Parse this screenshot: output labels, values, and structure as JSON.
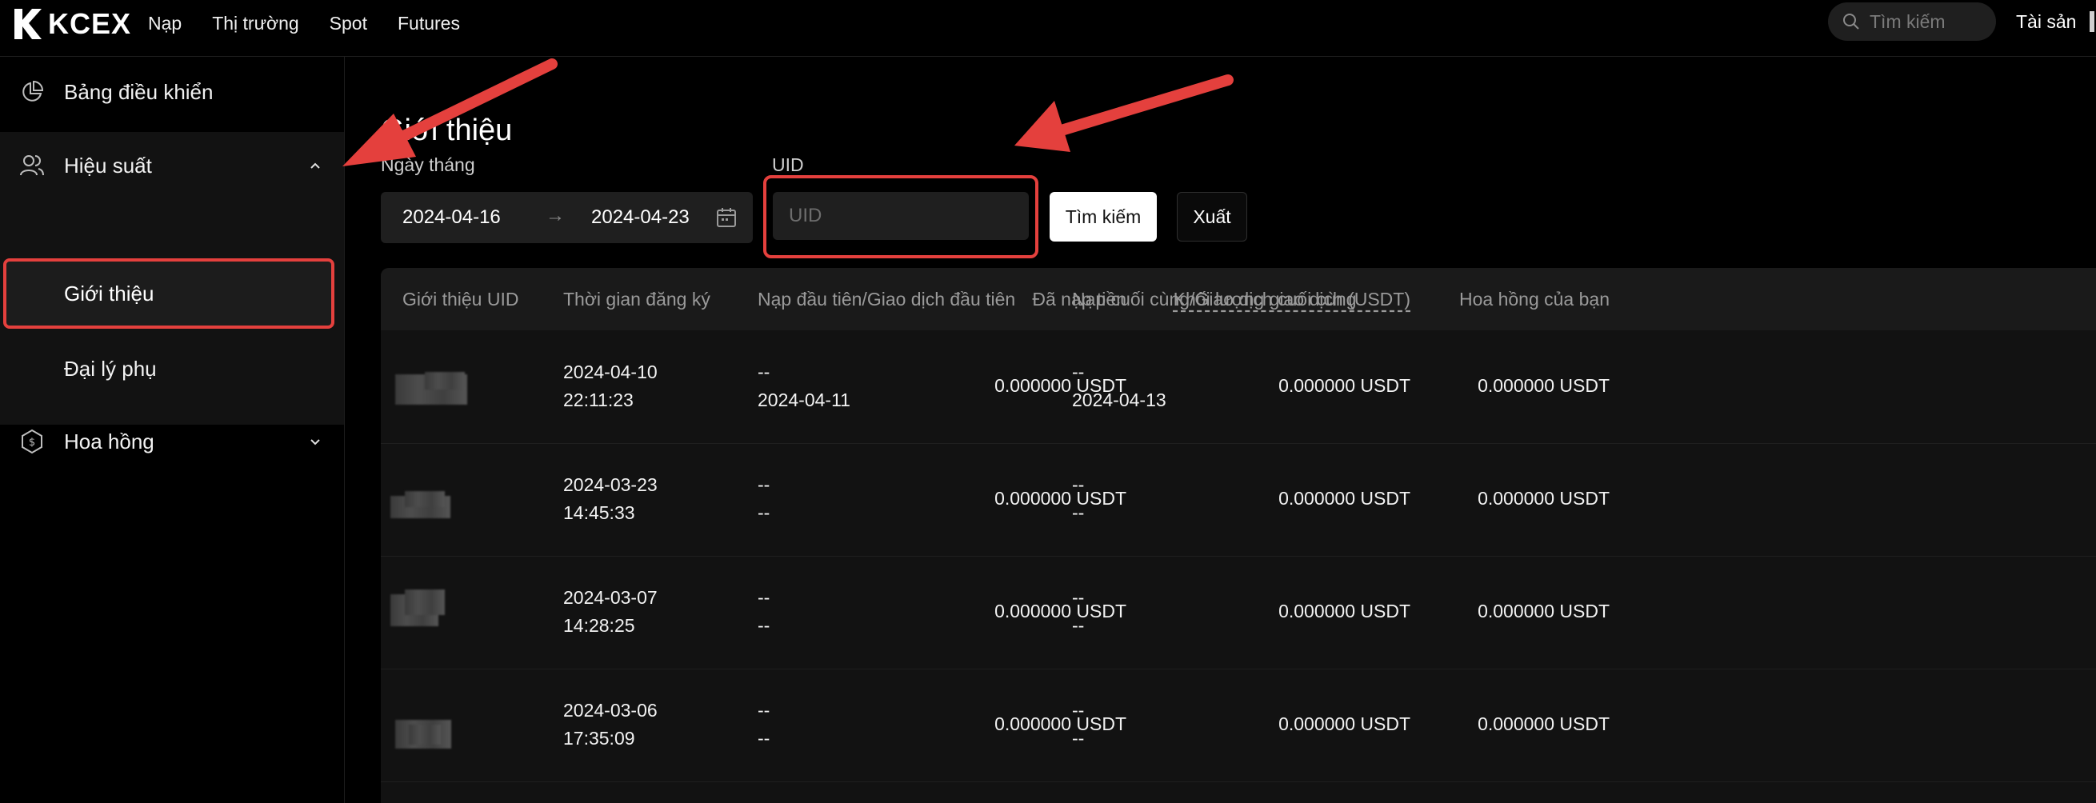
{
  "brand": {
    "name": "KCEX"
  },
  "nav": {
    "items": [
      "Nạp",
      "Thị trường",
      "Spot",
      "Futures"
    ]
  },
  "header": {
    "search_placeholder": "Tìm kiếm",
    "assets": "Tài sản"
  },
  "sidebar": {
    "items": [
      {
        "label": "Bảng điều khiển",
        "icon": "pie-chart-icon"
      },
      {
        "label": "Hiệu suất",
        "icon": "users-icon",
        "expanded": true
      },
      {
        "label": "Giới thiệu",
        "active": true
      },
      {
        "label": "Đại lý phụ"
      },
      {
        "label": "Hoa hồng",
        "icon": "coin-icon",
        "expanded": false
      }
    ]
  },
  "main": {
    "title": "Giới thiệu",
    "filters": {
      "date_label": "Ngày tháng",
      "date_start": "2024-04-16",
      "date_arrow": "→",
      "date_end": "2024-04-23",
      "uid_label": "UID",
      "uid_placeholder": "UID",
      "search_button": "Tìm kiếm",
      "export_button": "Xuất"
    },
    "table": {
      "headers": [
        "Giới thiệu UID",
        "Thời gian đăng ký",
        "Nạp đầu tiên/Giao dịch đầu tiên",
        "Nạp cuối cùng/Giao dịch cuối cùng",
        "Đã nạp tiền",
        "Khối lượng giao dịch (USDT)",
        "Hoa hồng của bạn"
      ],
      "rows": [
        {
          "reg_date": "2024-04-10",
          "reg_time": "22:11:23",
          "first_a": "--",
          "first_b": "2024-04-11",
          "last_a": "--",
          "last_b": "2024-04-13",
          "deposited": "0.000000 USDT",
          "volume": "0.000000 USDT",
          "commission": "0.000000 USDT"
        },
        {
          "reg_date": "2024-03-23",
          "reg_time": "14:45:33",
          "first_a": "--",
          "first_b": "--",
          "last_a": "--",
          "last_b": "--",
          "deposited": "0.000000 USDT",
          "volume": "0.000000 USDT",
          "commission": "0.000000 USDT"
        },
        {
          "reg_date": "2024-03-07",
          "reg_time": "14:28:25",
          "first_a": "--",
          "first_b": "--",
          "last_a": "--",
          "last_b": "--",
          "deposited": "0.000000 USDT",
          "volume": "0.000000 USDT",
          "commission": "0.000000 USDT"
        },
        {
          "reg_date": "2024-03-06",
          "reg_time": "17:35:09",
          "first_a": "--",
          "first_b": "--",
          "last_a": "--",
          "last_b": "--",
          "deposited": "0.000000 USDT",
          "volume": "0.000000 USDT",
          "commission": "0.000000 USDT"
        }
      ]
    }
  },
  "colors": {
    "annotation_red": "#e4403d",
    "background": "#000000",
    "panel": "#121212"
  }
}
